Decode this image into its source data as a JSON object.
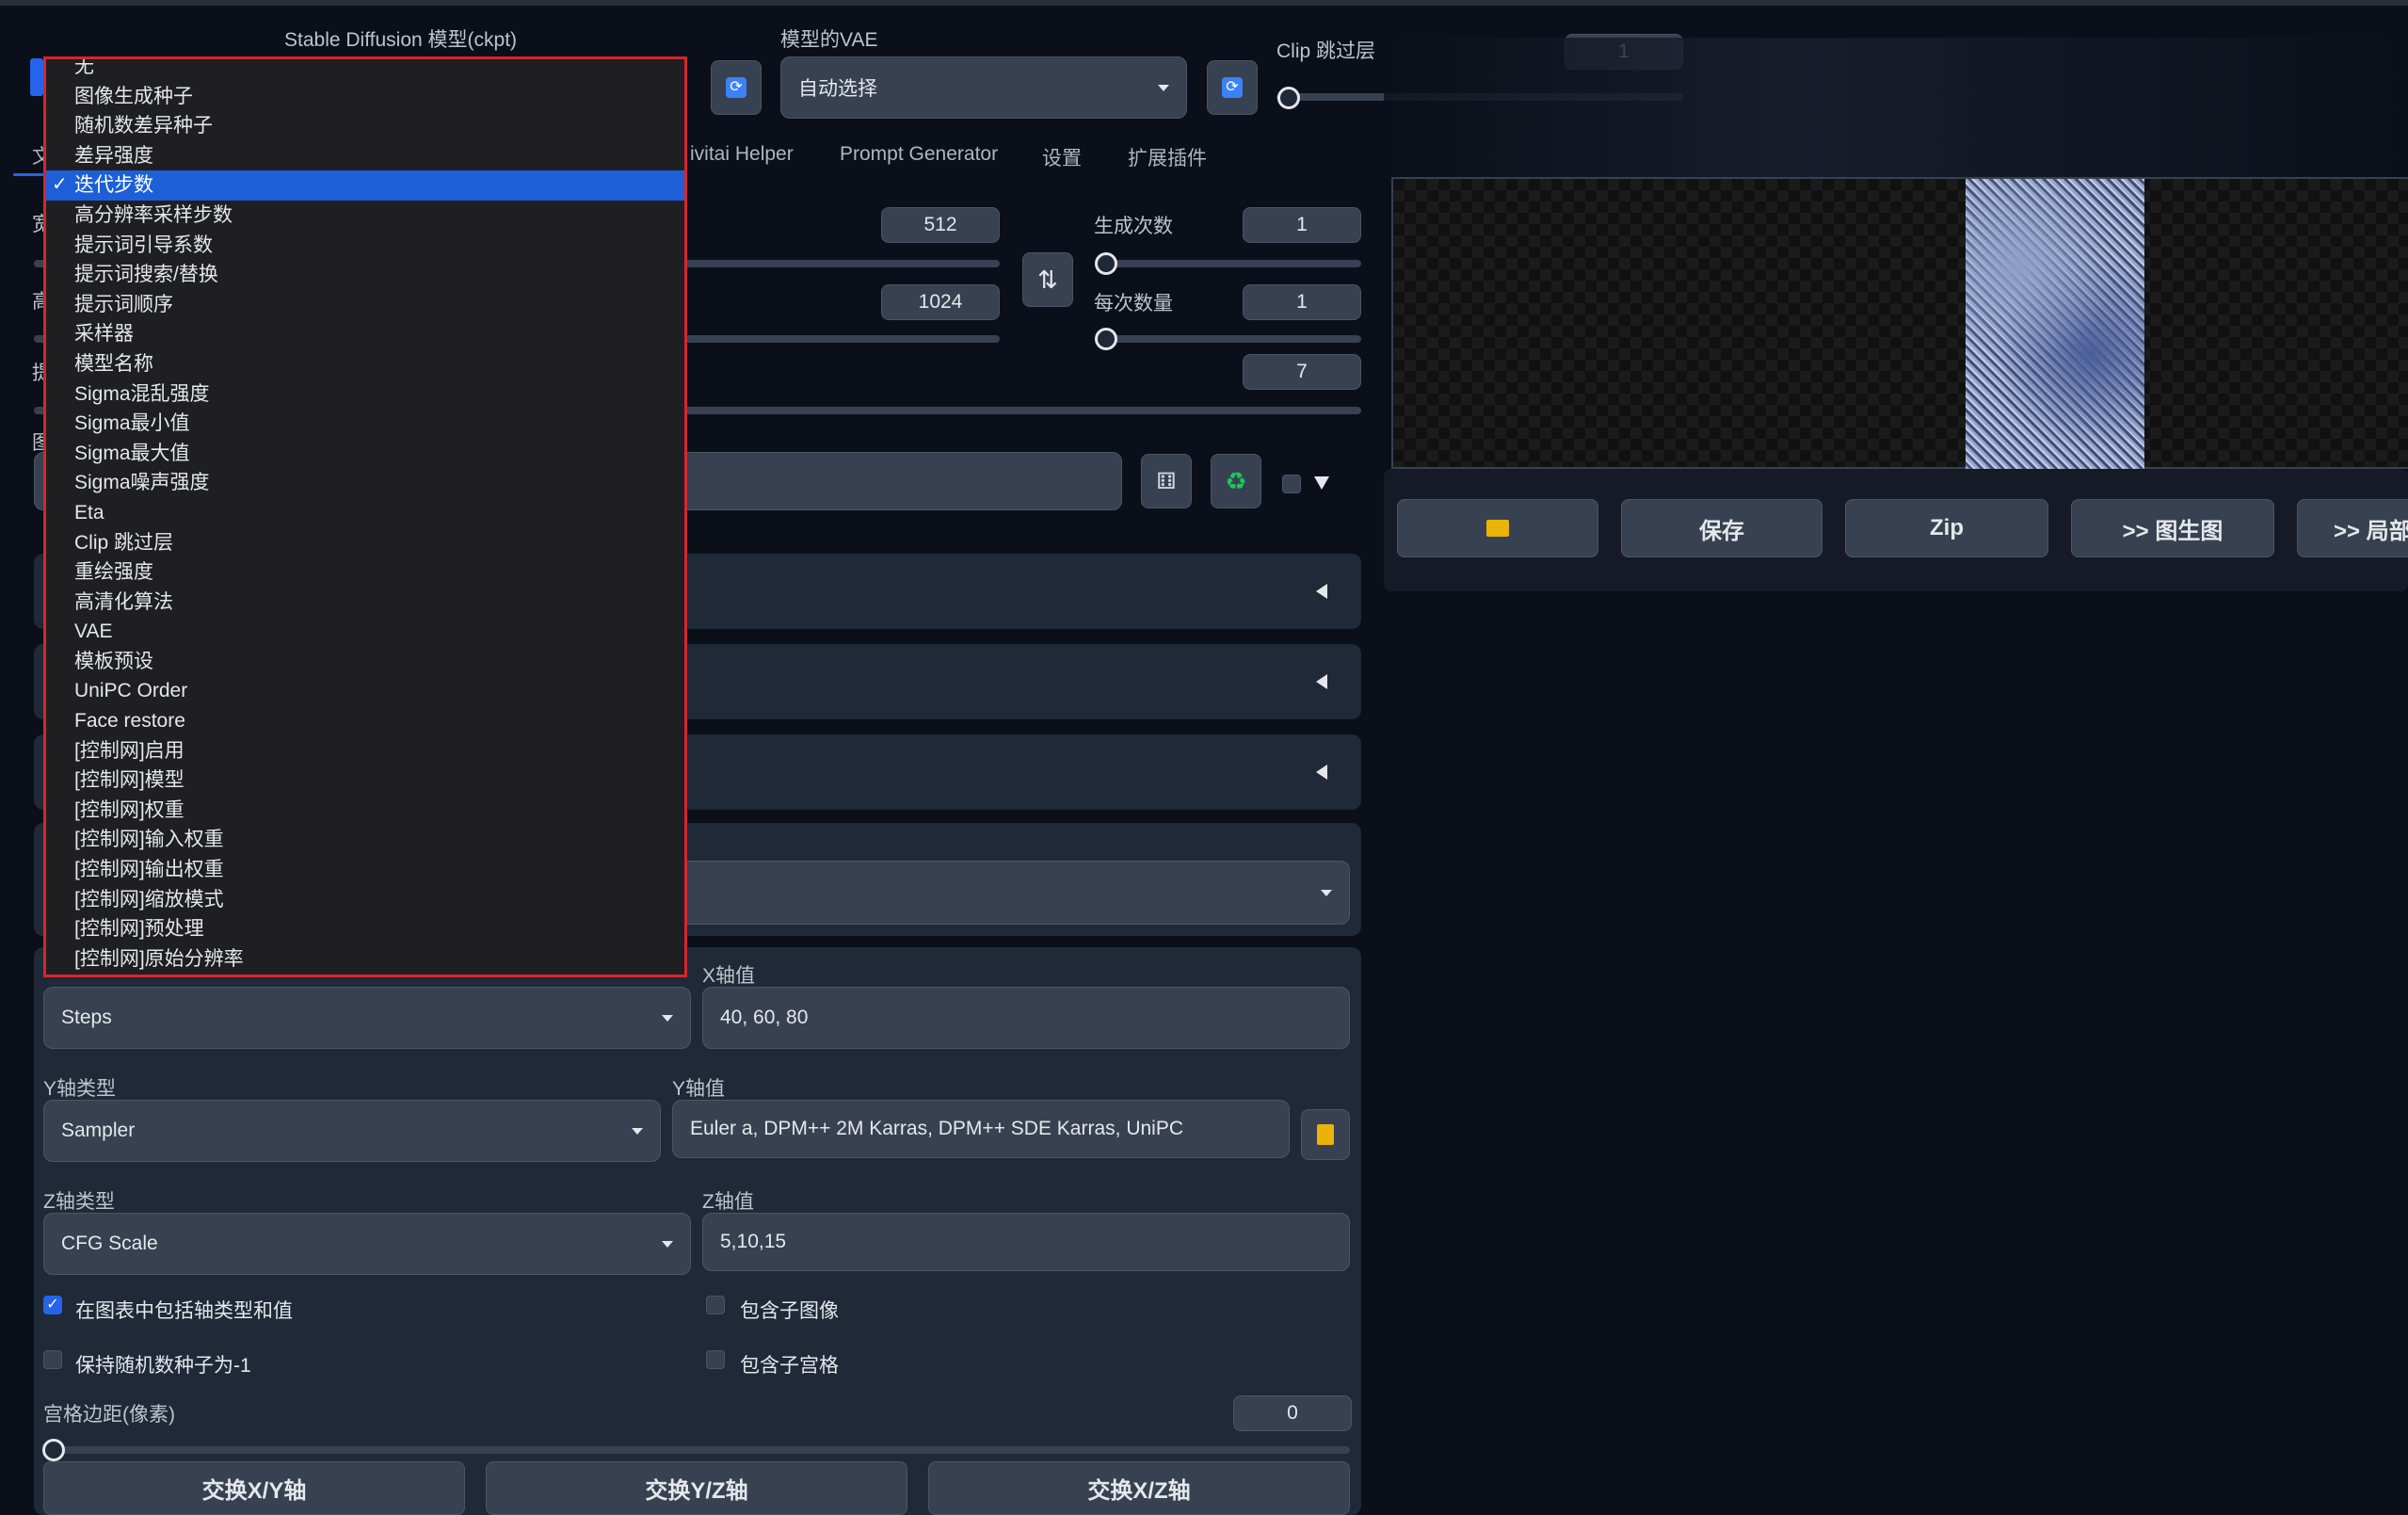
{
  "top": {
    "ckpt_label": "Stable Diffusion 模型(ckpt)",
    "vae_label": "模型的VAE",
    "vae_value": "自动选择",
    "clip_label": "Clip 跳过层",
    "clip_value": "1"
  },
  "tabs": [
    {
      "label": "文"
    },
    {
      "label": "ivitai Helper"
    },
    {
      "label": "Prompt Generator"
    },
    {
      "label": "设置"
    },
    {
      "label": "扩展插件"
    }
  ],
  "left_partial_labels": [
    "宽",
    "高",
    "提",
    "图"
  ],
  "params": {
    "width_value": "512",
    "height_value": "1024",
    "batch_count_label": "生成次数",
    "batch_count_value": "1",
    "batch_size_label": "每次数量",
    "batch_size_value": "1",
    "cfg_value": "7"
  },
  "dropdown": {
    "items": [
      "无",
      "图像生成种子",
      "随机数差异种子",
      "差异强度",
      "迭代步数",
      "高分辨率采样步数",
      "提示词引导系数",
      "提示词搜索/替换",
      "提示词顺序",
      "采样器",
      "模型名称",
      "Sigma混乱强度",
      "Sigma最小值",
      "Sigma最大值",
      "Sigma噪声强度",
      "Eta",
      "Clip 跳过层",
      "重绘强度",
      "高清化算法",
      "VAE",
      "模板预设",
      "UniPC Order",
      "Face restore",
      "[控制网]启用",
      "[控制网]模型",
      "[控制网]权重",
      "[控制网]输入权重",
      "[控制网]输出权重",
      "[控制网]缩放模式",
      "[控制网]预处理",
      "[控制网]原始分辨率"
    ],
    "selected_index": 4
  },
  "xyz": {
    "x_type_value": "Steps",
    "x_values_label": "X轴值",
    "x_values": "40, 60, 80",
    "y_type_label": "Y轴类型",
    "y_type_value": "Sampler",
    "y_values_label": "Y轴值",
    "y_values": "Euler a, DPM++ 2M Karras, DPM++ SDE Karras, UniPC",
    "z_type_label": "Z轴类型",
    "z_type_value": "CFG Scale",
    "z_values_label": "Z轴值",
    "z_values": "5,10,15",
    "include_labels": "在图表中包括轴类型和值",
    "include_sub_images": "包含子图像",
    "keep_seed": "保持随机数种子为-1",
    "include_sub_grids": "包含子宫格",
    "grid_margin_label": "宫格边距(像素)",
    "grid_margin_value": "0",
    "swap_xy": "交换X/Y轴",
    "swap_yz": "交换Y/Z轴",
    "swap_xz": "交换X/Z轴"
  },
  "output_buttons": {
    "save": "保存",
    "zip": "Zip",
    "to_img2img": ">> 图生图",
    "to_inpaint": ">> 局部"
  },
  "colors": {
    "accent": "#2563eb",
    "dropdown_border": "#d6262c",
    "background": "#0b0f19"
  }
}
